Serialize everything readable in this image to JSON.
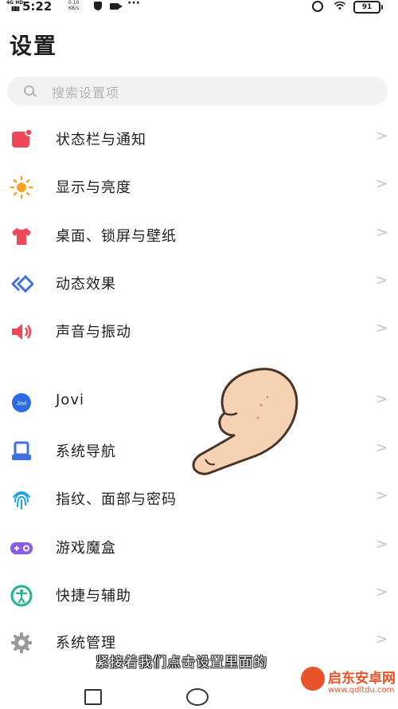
{
  "status_bar": {
    "network": "4G HD",
    "time": "5:22",
    "speed_value": "0.10",
    "speed_unit": "KB/s",
    "dots": "···",
    "battery": "91"
  },
  "header": {
    "title": "设置"
  },
  "search": {
    "placeholder": "搜索设置项"
  },
  "settings": {
    "items": [
      {
        "label": "状态栏与通知",
        "icon": "notification-square-icon",
        "color": "#f0465a"
      },
      {
        "label": "显示与亮度",
        "icon": "sun-icon",
        "color": "#f7a325"
      },
      {
        "label": "桌面、锁屏与壁纸",
        "icon": "tshirt-icon",
        "color": "#f0465a"
      },
      {
        "label": "动态效果",
        "icon": "diamond-motion-icon",
        "color": "#3f6fe0"
      },
      {
        "label": "声音与振动",
        "icon": "speaker-icon",
        "color": "#f0465a"
      },
      {
        "label": "Jovi",
        "icon": "jovi-icon",
        "color": "#2f6ae5"
      },
      {
        "label": "系统导航",
        "icon": "navigation-icon",
        "color": "#3f6fe0"
      },
      {
        "label": "指纹、面部与密码",
        "icon": "fingerprint-icon",
        "color": "#1aa3e0"
      },
      {
        "label": "游戏魔盒",
        "icon": "gamepad-icon",
        "color": "#8b5ce6"
      },
      {
        "label": "快捷与辅助",
        "icon": "accessibility-icon",
        "color": "#20b58f"
      },
      {
        "label": "系统管理",
        "icon": "gear-icon",
        "color": "#9a9a9a"
      }
    ],
    "chevron": ">"
  },
  "overlay": {
    "subtitle": "紧接着我们点击设置里面的"
  },
  "watermark": {
    "title": "启东安卓网",
    "url": "www.qdltdu.com"
  }
}
